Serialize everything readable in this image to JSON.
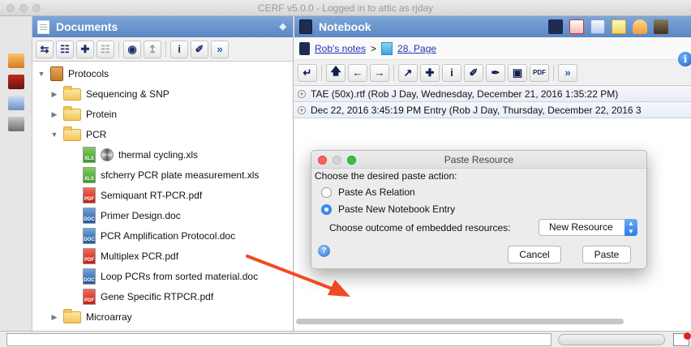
{
  "window": {
    "title": "CERF v5.0.0 - Logged in to attic as rjday"
  },
  "documents_panel": {
    "title": "Documents",
    "tree": [
      {
        "label": "Protocols",
        "kind": "cabinet",
        "expanded": true
      },
      {
        "label": "Sequencing & SNP",
        "kind": "folder"
      },
      {
        "label": "Protein",
        "kind": "folder"
      },
      {
        "label": "PCR",
        "kind": "folder",
        "expanded": true
      },
      {
        "label": "thermal cycling.xls",
        "kind": "xls"
      },
      {
        "label": "sfcherry PCR plate measurement.xls",
        "kind": "xls"
      },
      {
        "label": "Semiquant RT-PCR.pdf",
        "kind": "pdf"
      },
      {
        "label": "Primer Design.doc",
        "kind": "doc"
      },
      {
        "label": "PCR Amplification Protocol.doc",
        "kind": "doc"
      },
      {
        "label": "Multiplex PCR.pdf",
        "kind": "pdf"
      },
      {
        "label": "Loop PCRs from sorted material.doc",
        "kind": "doc"
      },
      {
        "label": "Gene Specific RTPCR.pdf",
        "kind": "pdf"
      },
      {
        "label": "Microarray",
        "kind": "folder"
      }
    ]
  },
  "notebook_panel": {
    "title": "Notebook",
    "breadcrumb": {
      "notebook": "Rob's notes",
      "separator": ">",
      "page": "28. Page"
    },
    "entries": [
      {
        "text": "TAE (50x).rtf (Rob J Day, Wednesday, December 21, 2016 1:35:22 PM)"
      },
      {
        "text": "Dec 22, 2016 3:45:19 PM Entry (Rob J Day, Thursday, December 22, 2016 3"
      }
    ]
  },
  "dialog": {
    "title": "Paste Resource",
    "prompt": "Choose the desired paste action:",
    "option_relation": "Paste As Relation",
    "option_entry": "Paste New Notebook Entry",
    "selected_option": "Paste New Notebook Entry",
    "outcome_label": "Choose outcome of embedded resources:",
    "outcome_value": "New Resource",
    "cancel_label": "Cancel",
    "paste_label": "Paste"
  },
  "colors": {
    "panel_header": "#5b87c4",
    "annotation_arrow": "#f04a23",
    "link": "#1a35b9"
  }
}
